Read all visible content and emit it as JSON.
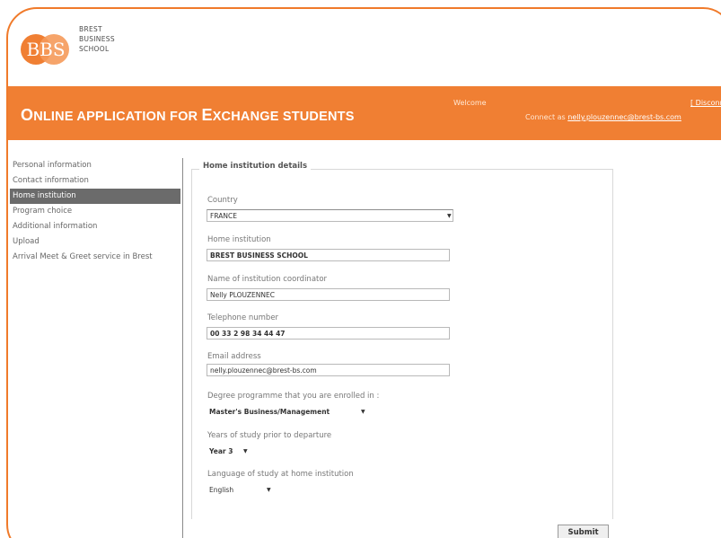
{
  "logo": {
    "mark": "BBS",
    "text": "BREST\nBUSINESS\nSCHOOL"
  },
  "header": {
    "title_cap1": "O",
    "title_rest1": "NLINE APPLICATION FOR ",
    "title_cap2": "E",
    "title_rest2": "XCHANGE STUDENTS",
    "welcome": "Welcome",
    "disconnect": "[ Disconnect ]",
    "connect_prefix": "Connect as",
    "connect_email": "nelly.plouzennec@brest-bs.com"
  },
  "sidebar": {
    "items": [
      {
        "label": "Personal information"
      },
      {
        "label": "Contact information"
      },
      {
        "label": "Home institution"
      },
      {
        "label": "Program choice"
      },
      {
        "label": "Additional information"
      },
      {
        "label": "Upload"
      },
      {
        "label": "Arrival Meet & Greet service in Brest"
      }
    ]
  },
  "form": {
    "legend": "Home institution details",
    "country": {
      "label": "Country",
      "value": "FRANCE"
    },
    "institution": {
      "label": "Home institution",
      "value": "BREST BUSINESS SCHOOL"
    },
    "coordinator": {
      "label": "Name of institution coordinator",
      "value": "Nelly PLOUZENNEC"
    },
    "phone": {
      "label": "Telephone number",
      "value": "00 33 2 98 34 44 47"
    },
    "email": {
      "label": "Email address",
      "value": "nelly.plouzennec@brest-bs.com"
    },
    "degree": {
      "label": "Degree programme that you are enrolled in :",
      "value": "Master's Business/Management"
    },
    "years": {
      "label": "Years of study prior to departure",
      "value": "Year 3"
    },
    "language": {
      "label": "Language of study at home institution",
      "value": "English"
    },
    "submit": "Submit"
  },
  "colors": {
    "accent": "#f07f33",
    "sidebar_active": "#6b6b6b"
  }
}
